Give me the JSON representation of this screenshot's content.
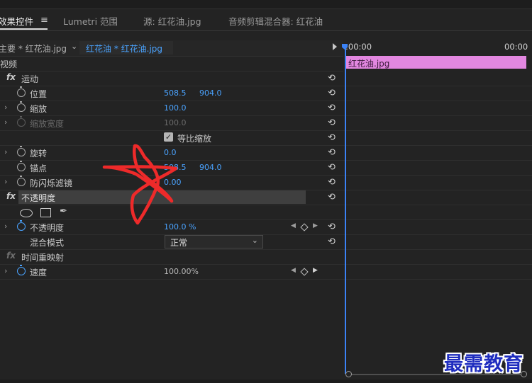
{
  "tabs": [
    {
      "label": "效果控件",
      "active": true
    },
    {
      "label": "Lumetri 范围",
      "active": false
    },
    {
      "label": "源: 红花油.jpg",
      "active": false
    },
    {
      "label": "音频剪辑混合器: 红花油",
      "active": false
    }
  ],
  "clip_header": {
    "master": "主要 * 红花油.jpg",
    "sequence": "红花油 * 红花油.jpg"
  },
  "section_video": "视频",
  "motion": {
    "label": "运动",
    "position": {
      "label": "位置",
      "x": "508.5",
      "y": "904.0"
    },
    "scale": {
      "label": "缩放",
      "value": "100.0"
    },
    "scale_width": {
      "label": "缩放宽度",
      "value": "100.0"
    },
    "uniform_scale": {
      "label": "等比缩放",
      "checked": true
    },
    "rotation": {
      "label": "旋转",
      "value": "0.0"
    },
    "anchor": {
      "label": "锚点",
      "x": "508.5",
      "y": "904.0"
    },
    "anti_flicker": {
      "label": "防闪烁滤镜",
      "value": "0.00"
    }
  },
  "opacity": {
    "header": "不透明度",
    "prop_label": "不透明度",
    "value": "100.0 %",
    "blend_label": "混合模式",
    "blend_value": "正常"
  },
  "time_remap": {
    "label": "时间重映射",
    "speed_label": "速度",
    "speed_value": "100.00%"
  },
  "timeline": {
    "tc_start": ":00:00",
    "tc_end": "00:00",
    "clip_name": "红花油.jpg",
    "clip_color": "#e287e0",
    "playhead_color": "#3b82f6"
  },
  "watermark": "最需教育",
  "annotation_color": "#ee2a2a"
}
